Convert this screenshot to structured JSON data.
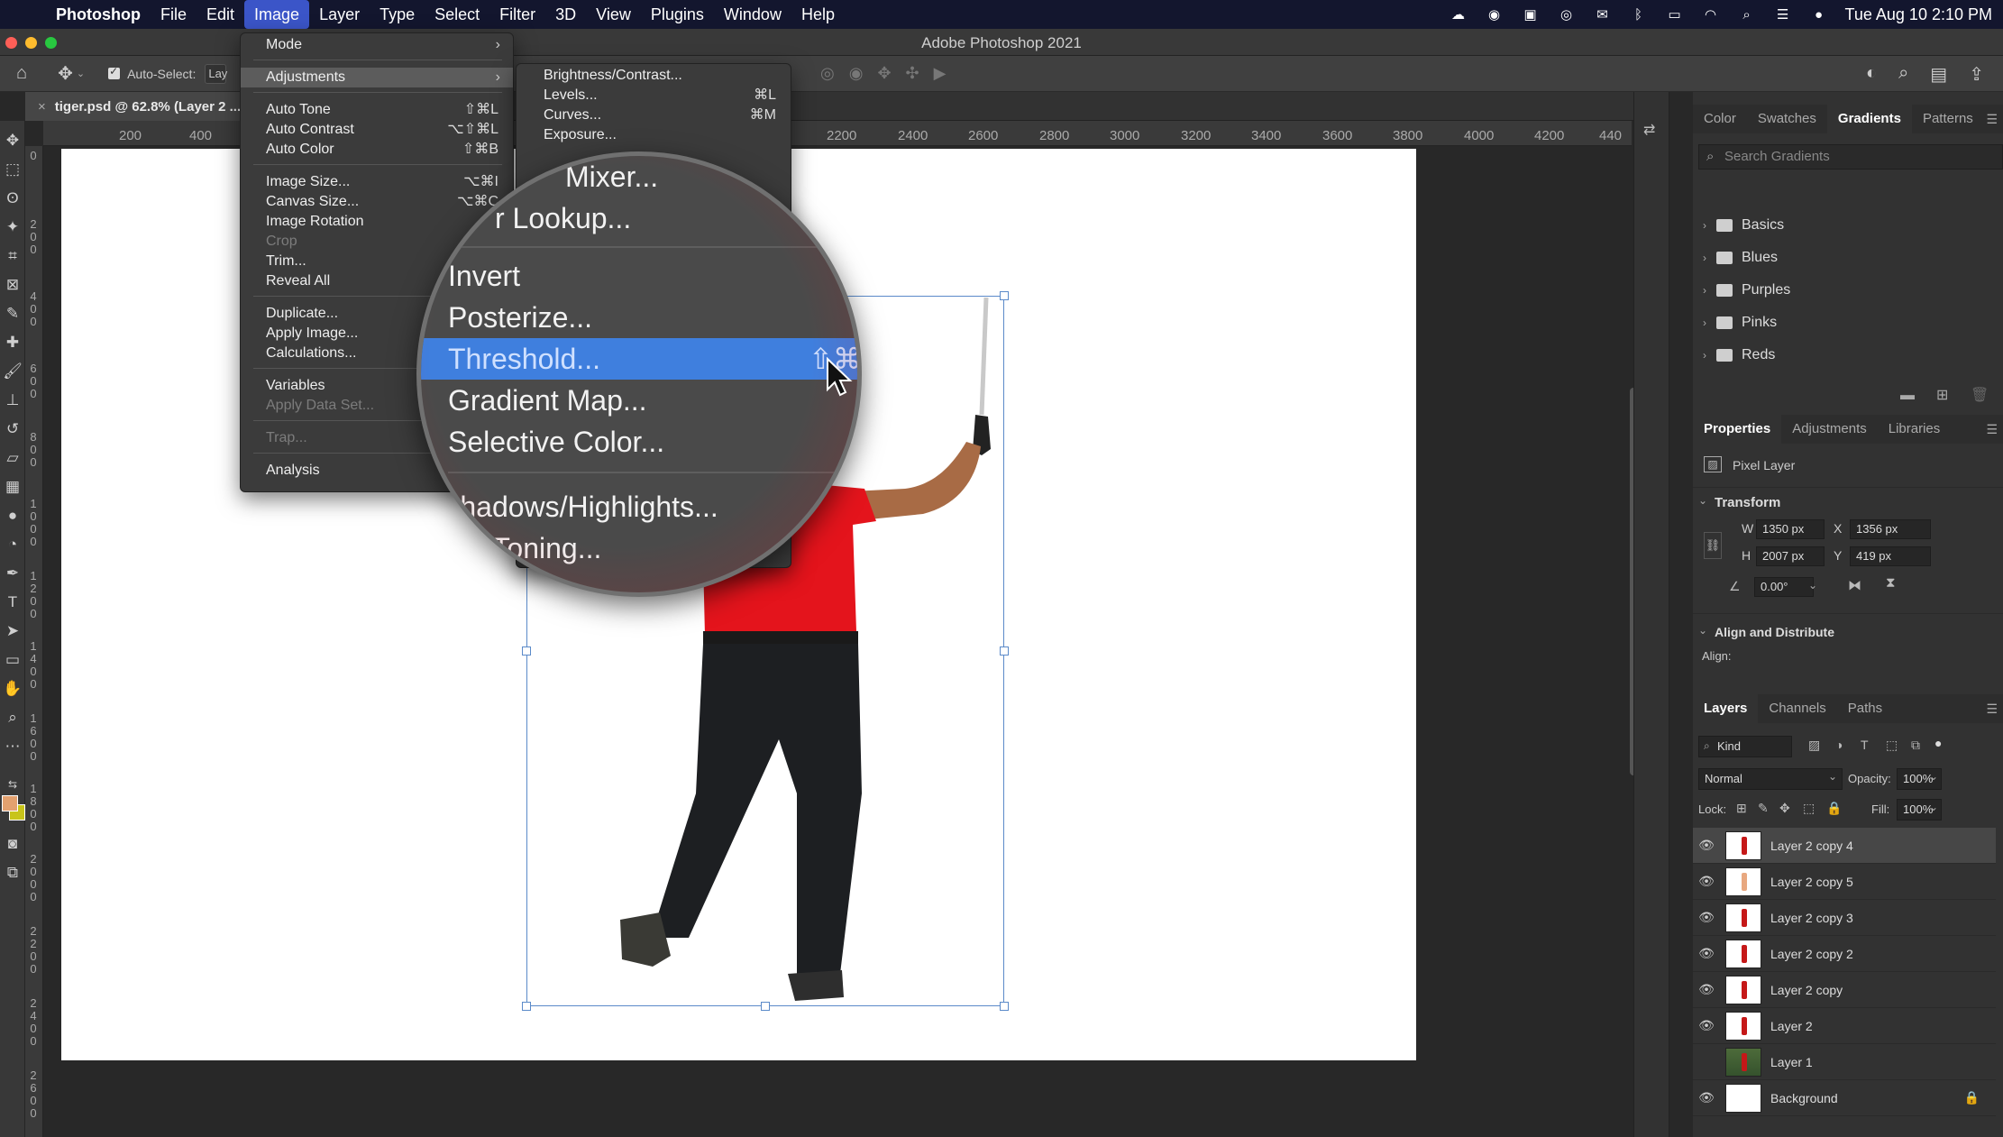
{
  "menubar": {
    "app": "Photoshop",
    "items": [
      "File",
      "Edit",
      "Image",
      "Layer",
      "Type",
      "Select",
      "Filter",
      "3D",
      "View",
      "Plugins",
      "Window",
      "Help"
    ],
    "clock": "Tue Aug 10  2:10 PM"
  },
  "window": {
    "title": "Adobe Photoshop 2021"
  },
  "options": {
    "auto_select_label": "Auto-Select:",
    "auto_select_value": "Lay"
  },
  "document": {
    "tab_title": "tiger.psd @ 62.8% (Layer 2 ..."
  },
  "rulers": {
    "h": [
      "200",
      "400",
      "2200",
      "2400",
      "2600",
      "2800",
      "3000",
      "3200",
      "3400",
      "3600",
      "3800",
      "4000",
      "4200",
      "440"
    ],
    "v": [
      "0",
      "200",
      "400",
      "600",
      "800",
      "1000",
      "1200",
      "1400",
      "1600",
      "1800",
      "2000",
      "2200",
      "2400",
      "2600"
    ]
  },
  "image_menu": {
    "items": [
      {
        "label": "Mode",
        "shortcut": "",
        "arrow": "›"
      },
      {
        "label": "Adjustments",
        "shortcut": "",
        "arrow": "›"
      },
      {
        "label": "Auto Tone",
        "shortcut": "⇧⌘L"
      },
      {
        "label": "Auto Contrast",
        "shortcut": "⌥⇧⌘L"
      },
      {
        "label": "Auto Color",
        "shortcut": "⇧⌘B"
      },
      {
        "label": "Image Size...",
        "shortcut": "⌥⌘I"
      },
      {
        "label": "Canvas Size...",
        "shortcut": "⌥⌘C"
      },
      {
        "label": "Image Rotation",
        "shortcut": ""
      },
      {
        "label": "Crop",
        "shortcut": ""
      },
      {
        "label": "Trim...",
        "shortcut": ""
      },
      {
        "label": "Reveal All",
        "shortcut": ""
      },
      {
        "label": "Duplicate...",
        "shortcut": ""
      },
      {
        "label": "Apply Image...",
        "shortcut": ""
      },
      {
        "label": "Calculations...",
        "shortcut": ""
      },
      {
        "label": "Variables",
        "shortcut": ""
      },
      {
        "label": "Apply Data Set...",
        "shortcut": ""
      },
      {
        "label": "Trap...",
        "shortcut": ""
      },
      {
        "label": "Analysis",
        "shortcut": ""
      }
    ]
  },
  "adjustments_menu": {
    "items": [
      {
        "label": "Brightness/Contrast...",
        "shortcut": ""
      },
      {
        "label": "Levels...",
        "shortcut": "⌘L"
      },
      {
        "label": "Curves...",
        "shortcut": "⌘M"
      },
      {
        "label": "Exposure...",
        "shortcut": ""
      }
    ]
  },
  "magnifier": {
    "items": [
      "Mixer...",
      "r Lookup...",
      "Invert",
      "Posterize...",
      "Threshold...",
      "Gradient Map...",
      "Selective Color...",
      "Shadows/Highlights...",
      "R Toning..."
    ],
    "highlighted_shortcut": "⇧⌘"
  },
  "gradients_panel": {
    "tabs": [
      "Color",
      "Swatches",
      "Gradients",
      "Patterns"
    ],
    "search_placeholder": "Search Gradients",
    "folders": [
      "Basics",
      "Blues",
      "Purples",
      "Pinks",
      "Reds"
    ]
  },
  "properties_panel": {
    "tabs": [
      "Properties",
      "Adjustments",
      "Libraries"
    ],
    "layer_type": "Pixel Layer",
    "transform_title": "Transform",
    "w_label": "W",
    "w": "1350 px",
    "x_label": "X",
    "x": "1356 px",
    "h_label": "H",
    "h": "2007 px",
    "y_label": "Y",
    "y": "419 px",
    "angle": "0.00°",
    "align_title": "Align and Distribute",
    "align_label": "Align:"
  },
  "layers_panel": {
    "tabs": [
      "Layers",
      "Channels",
      "Paths"
    ],
    "kind": "Kind",
    "blend_mode": "Normal",
    "opacity_label": "Opacity:",
    "opacity": "100%",
    "lock_label": "Lock:",
    "fill_label": "Fill:",
    "fill": "100%",
    "layers": [
      "Layer 2 copy 4",
      "Layer 2 copy 5",
      "Layer 2 copy 3",
      "Layer 2 copy 2",
      "Layer 2 copy",
      "Layer 2",
      "Layer 1",
      "Background"
    ]
  },
  "colors": {
    "menubar_bg": "#13162e",
    "menu_active": "#3b55c8",
    "highlight": "#3f7fde",
    "foreground_swatch": "#e3a16f",
    "background_swatch": "#c8c41a"
  }
}
